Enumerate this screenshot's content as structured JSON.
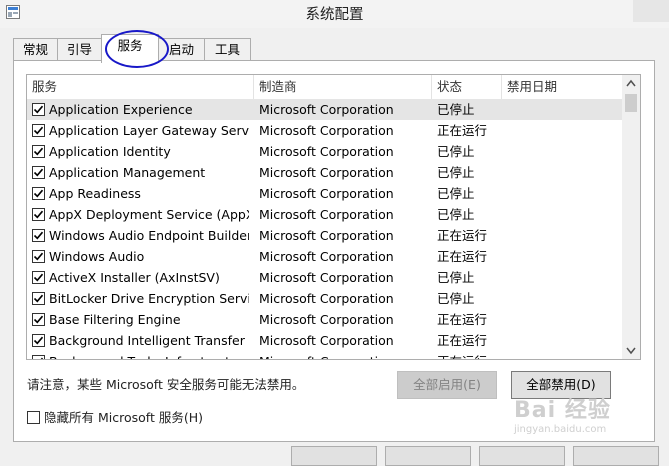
{
  "window": {
    "title": "系统配置"
  },
  "tabs": [
    {
      "label": "常规"
    },
    {
      "label": "引导"
    },
    {
      "label": "服务"
    },
    {
      "label": "启动"
    },
    {
      "label": "工具"
    }
  ],
  "active_tab": "服务",
  "services_table": {
    "columns": [
      "服务",
      "制造商",
      "状态",
      "禁用日期"
    ],
    "rows": [
      {
        "service": "Application Experience",
        "manufacturer": "Microsoft Corporation",
        "status": "已停止",
        "checked": true
      },
      {
        "service": "Application Layer Gateway Service",
        "manufacturer": "Microsoft Corporation",
        "status": "正在运行",
        "checked": true
      },
      {
        "service": "Application Identity",
        "manufacturer": "Microsoft Corporation",
        "status": "已停止",
        "checked": true
      },
      {
        "service": "Application Management",
        "manufacturer": "Microsoft Corporation",
        "status": "已停止",
        "checked": true
      },
      {
        "service": "App Readiness",
        "manufacturer": "Microsoft Corporation",
        "status": "已停止",
        "checked": true
      },
      {
        "service": "AppX Deployment Service (AppX...",
        "manufacturer": "Microsoft Corporation",
        "status": "已停止",
        "checked": true
      },
      {
        "service": "Windows Audio Endpoint Builder",
        "manufacturer": "Microsoft Corporation",
        "status": "正在运行",
        "checked": true
      },
      {
        "service": "Windows Audio",
        "manufacturer": "Microsoft Corporation",
        "status": "正在运行",
        "checked": true
      },
      {
        "service": "ActiveX Installer (AxInstSV)",
        "manufacturer": "Microsoft Corporation",
        "status": "已停止",
        "checked": true
      },
      {
        "service": "BitLocker Drive Encryption Service",
        "manufacturer": "Microsoft Corporation",
        "status": "已停止",
        "checked": true
      },
      {
        "service": "Base Filtering Engine",
        "manufacturer": "Microsoft Corporation",
        "status": "正在运行",
        "checked": true
      },
      {
        "service": "Background Intelligent Transfer ...",
        "manufacturer": "Microsoft Corporation",
        "status": "正在运行",
        "checked": true
      },
      {
        "service": "Background Tasks Infrastructure ...",
        "manufacturer": "Microsoft Corporation",
        "status": "正在运行",
        "checked": true
      }
    ]
  },
  "notice": "请注意，某些 Microsoft 安全服务可能无法禁用。",
  "buttons": {
    "enable_all": "全部启用(E)",
    "disable_all": "全部禁用(D)"
  },
  "hide_ms_services": {
    "label": "隐藏所有 Microsoft 服务(H)",
    "checked": false
  },
  "watermark": {
    "main": "Bai 经验",
    "sub": "jingyan.baidu.com"
  },
  "colors": {
    "annotation_circle": "#1818c8",
    "selected_row": "#e5e5e5"
  }
}
